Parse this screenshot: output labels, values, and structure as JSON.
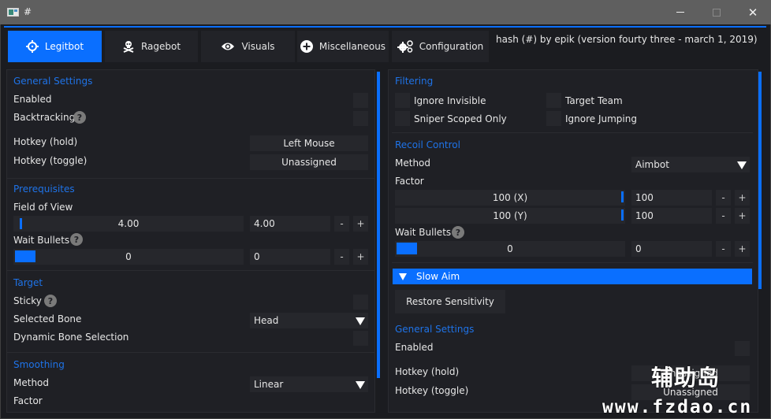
{
  "window": {
    "title": "#",
    "controls": {
      "minimize": "minimize",
      "maximize": "maximize",
      "close": "✕"
    }
  },
  "tabs": [
    {
      "label": "Legitbot",
      "icon": "crosshair-icon",
      "active": true
    },
    {
      "label": "Ragebot",
      "icon": "skull-crossbones-icon",
      "active": false
    },
    {
      "label": "Visuals",
      "icon": "eye-icon",
      "active": false
    },
    {
      "label": "Miscellaneous",
      "icon": "plus-circle-icon",
      "active": false
    },
    {
      "label": "Configuration",
      "icon": "cogs-icon",
      "active": false
    }
  ],
  "version_text": "hash (#) by epik (version fourty three - march 1, 2019)",
  "accent_color": "#0a6fff",
  "left_panel": {
    "general": {
      "title": "General Settings",
      "enabled_label": "Enabled",
      "enabled_checked": false,
      "backtracking_label": "Backtracking",
      "backtracking_checked": false,
      "hotkey_hold_label": "Hotkey (hold)",
      "hotkey_hold_value": "Left Mouse",
      "hotkey_toggle_label": "Hotkey (toggle)",
      "hotkey_toggle_value": "Unassigned"
    },
    "prerequisites": {
      "title": "Prerequisites",
      "fov_label": "Field of View",
      "fov_slider_text": "4.00",
      "fov_input": "4.00",
      "wait_bullets_label": "Wait Bullets",
      "wait_bullets_slider_text": "0",
      "wait_bullets_input": "0",
      "minus": "-",
      "plus": "+"
    },
    "target": {
      "title": "Target",
      "sticky_label": "Sticky",
      "sticky_checked": false,
      "selected_bone_label": "Selected Bone",
      "selected_bone_value": "Head",
      "dynamic_bone_label": "Dynamic Bone Selection",
      "dynamic_bone_checked": false
    },
    "smoothing": {
      "title": "Smoothing",
      "method_label": "Method",
      "method_value": "Linear",
      "factor_label": "Factor"
    }
  },
  "right_panel": {
    "filtering": {
      "title": "Filtering",
      "ignore_invisible": "Ignore Invisible",
      "target_team": "Target Team",
      "sniper_scoped_only": "Sniper Scoped Only",
      "ignore_jumping": "Ignore Jumping"
    },
    "recoil_control": {
      "title": "Recoil Control",
      "method_label": "Method",
      "method_value": "Aimbot",
      "factor_label": "Factor",
      "factor_x_slider_text": "100 (X)",
      "factor_x_input": "100",
      "factor_y_slider_text": "100 (Y)",
      "factor_y_input": "100",
      "wait_bullets_label": "Wait Bullets",
      "wait_bullets_slider_text": "0",
      "wait_bullets_input": "0",
      "minus": "-",
      "plus": "+"
    },
    "slow_aim": {
      "header": "Slow Aim",
      "restore_sensitivity": "Restore Sensitivity",
      "general_title": "General Settings",
      "enabled_label": "Enabled",
      "hotkey_hold_label": "Hotkey (hold)",
      "hotkey_hold_value": "Unassigned",
      "hotkey_toggle_label": "Hotkey (toggle)",
      "hotkey_toggle_value": "Unassigned"
    }
  },
  "watermark": {
    "cn": "辅助岛",
    "url": "www.fzdao.cn"
  }
}
